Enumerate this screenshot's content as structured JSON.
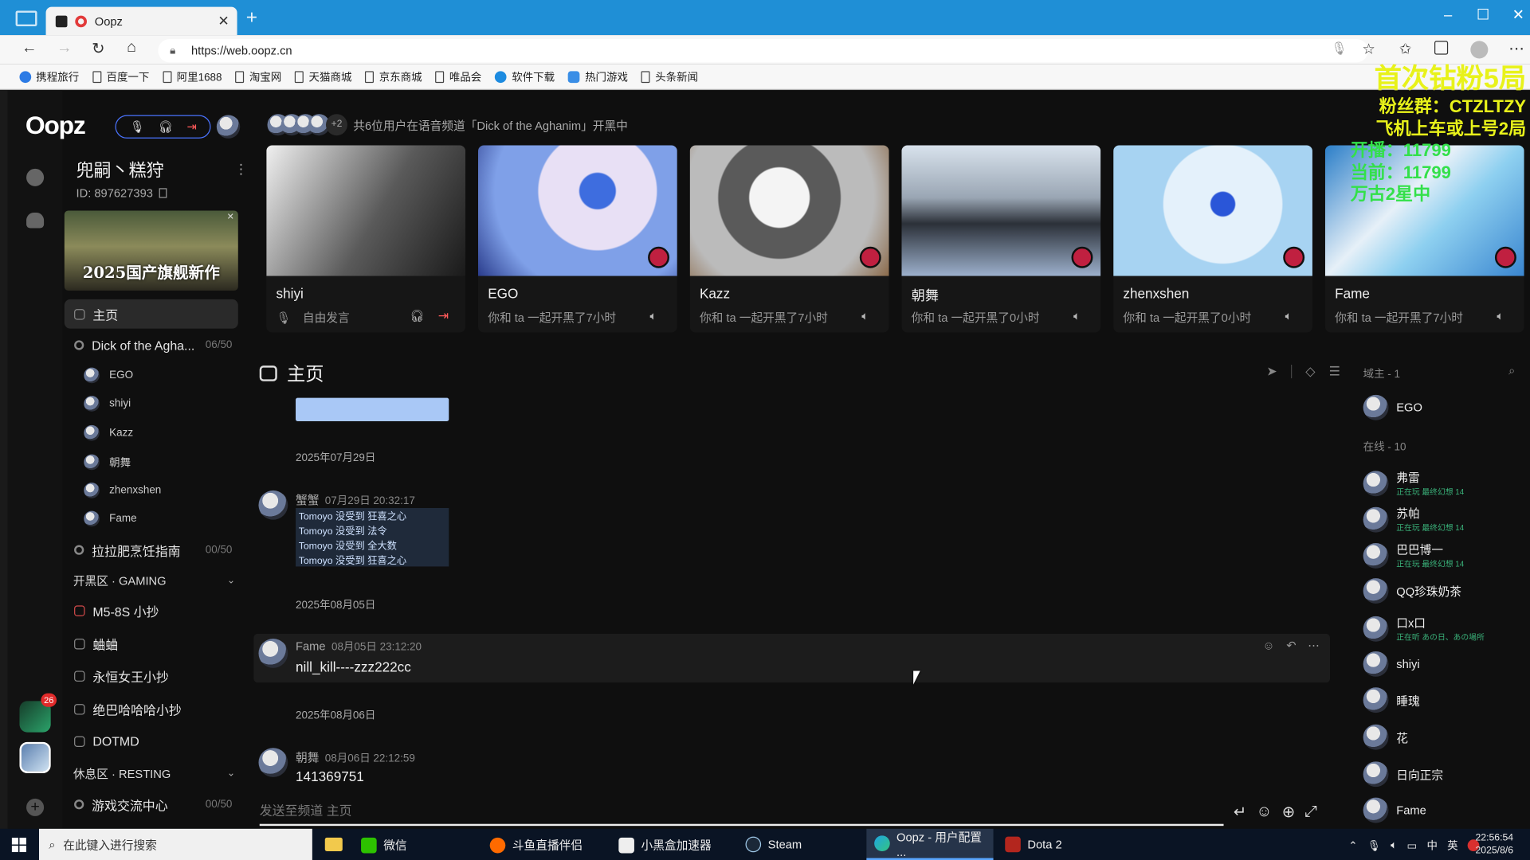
{
  "browser": {
    "tab_title": "Oopz",
    "url": "https://web.oopz.cn",
    "bookmarks": [
      "携程旅行",
      "百度一下",
      "阿里1688",
      "淘宝网",
      "天猫商城",
      "京东商城",
      "唯品会",
      "软件下载",
      "热门游戏",
      "头条新闻"
    ]
  },
  "app": {
    "logo": "Oopz",
    "server_name": "兜嗣丶糕狩",
    "server_id": "ID: 897627393",
    "banner_text": "2025国产旗舰新作",
    "nav": {
      "home": "主页",
      "voice_channel": "Dick of the Agha...",
      "voice_count": "06/50",
      "voice_members": [
        "EGO",
        "shiyi",
        "Kazz",
        "朝舞",
        "zhenxshen",
        "Fame"
      ],
      "channel2": "拉拉肥烹饪指南",
      "channel2_count": "00/50",
      "group_gaming": "开黑区 · GAMING",
      "gaming_channels": [
        "M5-8S 小抄",
        "蛐蛐",
        "永恒女王小抄",
        "绝巴哈哈哈小抄",
        "DOTMD"
      ],
      "group_resting": "休息区 · RESTING",
      "resting_channel": "游戏交流中心",
      "resting_count": "00/50"
    },
    "rail_badge": "26",
    "voice_header": {
      "more": "+2",
      "text": "共6位用户在语音频道「Dick of the Aghanim」开黑中"
    },
    "cards": [
      {
        "name": "shiyi",
        "status": "自由发言"
      },
      {
        "name": "EGO",
        "status": "你和 ta 一起开黑了7小时"
      },
      {
        "name": "Kazz",
        "status": "你和 ta 一起开黑了7小时"
      },
      {
        "name": "朝舞",
        "status": "你和 ta 一起开黑了0小时"
      },
      {
        "name": "zhenxshen",
        "status": "你和 ta 一起开黑了0小时"
      },
      {
        "name": "Fame",
        "status": "你和 ta 一起开黑了7小时"
      }
    ],
    "overlay": {
      "l1": "首次钻粉5局",
      "l2": "粉丝群：CTZLTZY",
      "l3": "飞机上车或上号2局",
      "l4": "开播：11799",
      "l5": "当前：11799",
      "l6": "万古2星中"
    },
    "channel_title": "主页",
    "messages": {
      "date1": "2025年07月29日",
      "m1_author": "蟹蟹",
      "m1_time": "07月29日 20:32:17",
      "m1_lines": [
        "Tomoyo 没受到 狂喜之心",
        "Tomoyo 没受到 法令",
        "Tomoyo 没受到 全大数",
        "Tomoyo 没受到 狂喜之心"
      ],
      "date2": "2025年08月05日",
      "m2_author": "Fame",
      "m2_time": "08月05日 23:12:20",
      "m2_text": "nill_kill----zzz222cc",
      "date3": "2025年08月06日",
      "m3_author": "朝舞",
      "m3_time": "08月06日 22:12:59",
      "m3_text": "141369751"
    },
    "composer_placeholder": "发送至频道 主页",
    "members": {
      "owner_header": "域主 - 1",
      "owner": "EGO",
      "online_header": "在线 - 10",
      "list": [
        {
          "name": "弗雷",
          "activity": "正在玩 最终幻想 14"
        },
        {
          "name": "苏帕",
          "activity": "正在玩 最终幻想 14"
        },
        {
          "name": "巴巴博一",
          "activity": "正在玩 最终幻想 14"
        },
        {
          "name": "QQ珍珠奶茶",
          "activity": ""
        },
        {
          "name": "口x口",
          "activity": "正在听 あの日、あの場所"
        },
        {
          "name": "shiyi",
          "activity": ""
        },
        {
          "name": "睡瑰",
          "activity": ""
        },
        {
          "name": "花",
          "activity": ""
        },
        {
          "name": "日向正宗",
          "activity": ""
        },
        {
          "name": "Fame",
          "activity": ""
        }
      ]
    }
  },
  "taskbar": {
    "search_placeholder": "在此键入进行搜索",
    "apps": [
      "微信",
      "斗鱼直播伴侣",
      "小黑盒加速器",
      "Steam",
      "Oopz - 用户配置 ...",
      "Dota 2"
    ],
    "ime": "英",
    "time": "22:56:54",
    "date": "2025/8/6"
  },
  "colors": {
    "accent": "#4a73ff",
    "overlay_yellow": "#e8f21a",
    "overlay_green": "#33e04a",
    "chrome_blue": "#1f8fd6"
  }
}
